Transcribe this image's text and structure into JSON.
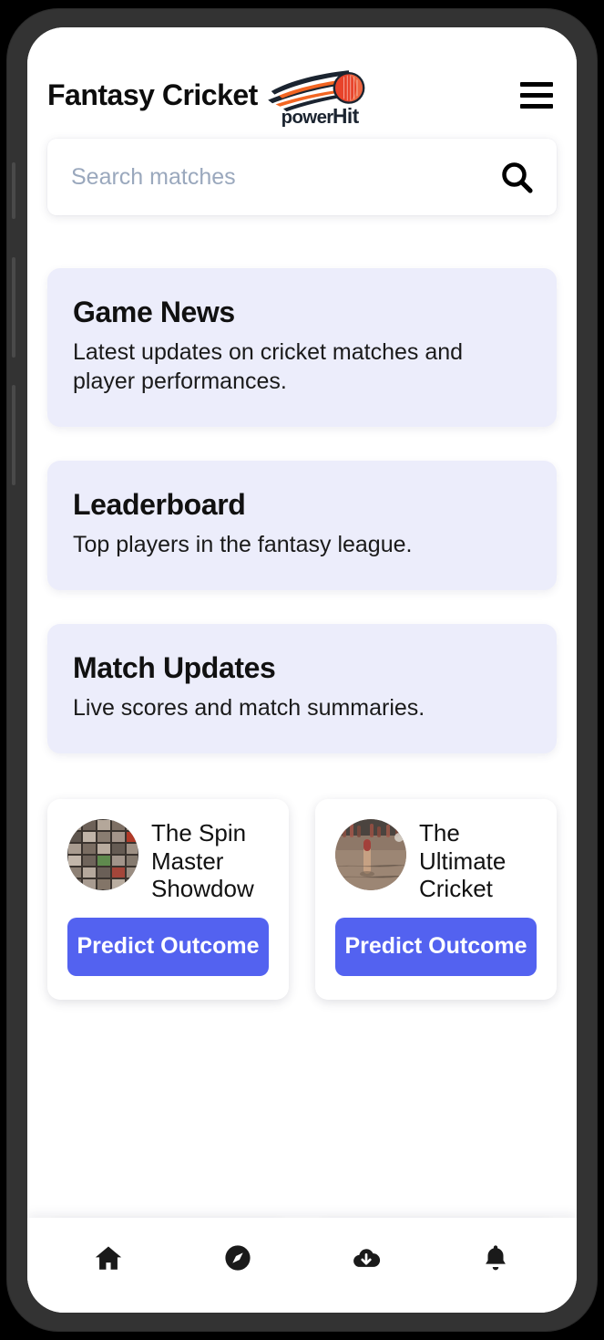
{
  "header": {
    "title": "Fantasy Cricket",
    "logo_text": "powerHit",
    "menu_icon": "hamburger-menu-icon"
  },
  "search": {
    "placeholder": "Search matches",
    "value": "",
    "icon": "search-icon"
  },
  "info_cards": [
    {
      "title": "Game News",
      "description": "Latest updates on cricket matches and player performances."
    },
    {
      "title": "Leaderboard",
      "description": "Top players in the fantasy league."
    },
    {
      "title": "Match Updates",
      "description": "Live scores and match summaries."
    }
  ],
  "matches": [
    {
      "name": "The Spin Master Showdow",
      "thumbnail": "photo-collage-thumbnail",
      "button_label": "Predict Outcome"
    },
    {
      "name": "The Ultimate Cricket",
      "thumbnail": "cricket-stumps-thumbnail",
      "button_label": "Predict Outcome"
    }
  ],
  "bottom_nav": [
    {
      "icon": "home-icon",
      "label": "Home"
    },
    {
      "icon": "compass-icon",
      "label": "Explore"
    },
    {
      "icon": "cloud-download-icon",
      "label": "Downloads"
    },
    {
      "icon": "bell-icon",
      "label": "Notifications"
    }
  ],
  "colors": {
    "accent": "#5362f0",
    "card_background": "#ecedfb",
    "screen_background": "#ffffff",
    "frame": "#333333",
    "placeholder_text": "#9aa8bd",
    "text_primary": "#111111",
    "logo_orange": "#f26522",
    "logo_dark": "#1b2430"
  }
}
